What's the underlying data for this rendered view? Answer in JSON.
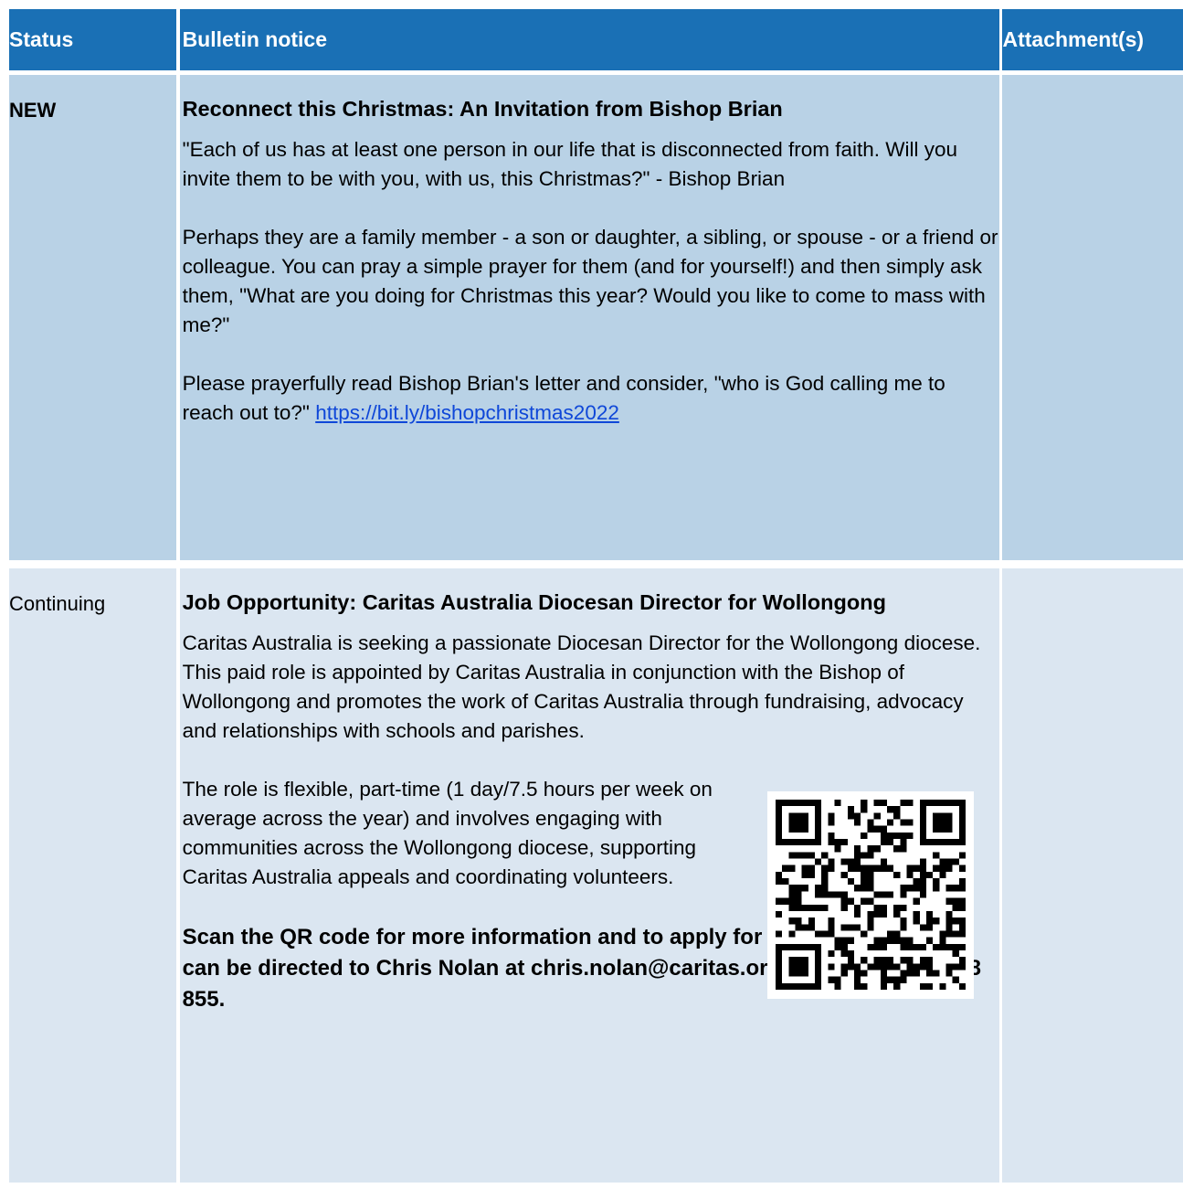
{
  "header": {
    "status": "Status",
    "notice": "Bulletin notice",
    "attachments": "Attachment(s)"
  },
  "rows": [
    {
      "status": "NEW",
      "title": "Reconnect this Christmas: An Invitation from Bishop Brian",
      "paragraphs": [
        "\"Each of us has at least one person in our life that is disconnected from faith. Will you invite them to be with you, with us, this Christmas?\" - Bishop Brian",
        "Perhaps they are a family member - a son or daughter, a sibling, or spouse - or a friend or colleague. You can pray a simple prayer for them (and for yourself!) and then simply ask them, \"What are you doing for Christmas this year? Would you like to come to mass with me?\"",
        "Please prayerfully read Bishop Brian's letter and consider, \"who is God calling me to reach out to?\""
      ],
      "link": "https://bit.ly/bishopchristmas2022"
    },
    {
      "status": "Continuing",
      "title": "Job Opportunity: Caritas Australia Diocesan Director for Wollongong",
      "paragraphs": [
        "Caritas Australia is seeking a passionate Diocesan Director for the Wollongong diocese. This paid role is appointed by Caritas Australia in conjunction with the Bishop of Wollongong and promotes the work of Caritas Australia through fundraising, advocacy and relationships with schools and parishes.",
        "The role is flexible, part-time (1 day/7.5 hours per week on average across the year) and involves engaging with communities across the Wollongong diocese, supporting Caritas Australia appeals and coordinating volunteers."
      ],
      "closing": "Scan the QR code for more information and to apply for this role. Questions can be directed to Chris Nolan at chris.nolan@caritas.org.au or call 0429 368 855."
    }
  ],
  "colors": {
    "header_bg": "#1a70b5",
    "row1_bg": "#b9d2e6",
    "row2_bg": "#dbe6f1",
    "link": "#0f47d8"
  },
  "qr_icon": "qr-code-icon"
}
